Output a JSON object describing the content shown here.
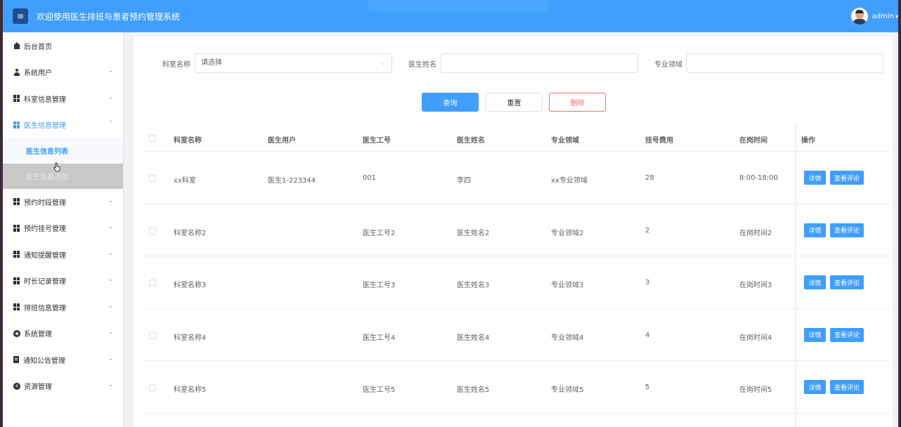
{
  "header": {
    "title": "欢迎使用医生排班与患者预约管理系统",
    "username": "admin"
  },
  "sidebar": {
    "items": [
      {
        "label": "后台首页",
        "icon": "home-icon"
      },
      {
        "label": "系统用户",
        "icon": "user-icon"
      },
      {
        "label": "科室信息管理",
        "icon": "grid-icon"
      },
      {
        "label": "医生信息管理",
        "icon": "grid-icon"
      },
      {
        "label": "预约时段管理",
        "icon": "grid-icon"
      },
      {
        "label": "预约挂号管理",
        "icon": "grid-icon"
      },
      {
        "label": "通知提醒管理",
        "icon": "grid-icon"
      },
      {
        "label": "时长记录管理",
        "icon": "grid-icon"
      },
      {
        "label": "排班信息管理",
        "icon": "grid-icon"
      },
      {
        "label": "系统管理",
        "icon": "gear-icon"
      },
      {
        "label": "通知公告管理",
        "icon": "doc-icon"
      },
      {
        "label": "资源管理",
        "icon": "plus-icon"
      }
    ],
    "submenu": {
      "active": "医生信息列表",
      "hovered": "医生信息添加"
    }
  },
  "filters": {
    "dept_label": "科室名称",
    "dept_placeholder": "请选择",
    "name_label": "医生姓名",
    "field_label": "专业领域"
  },
  "buttons": {
    "query": "查询",
    "reset": "重置",
    "delete": "删除",
    "detail": "详情",
    "review": "查看评论"
  },
  "table": {
    "columns": [
      "科室名称",
      "医生用户",
      "医生工号",
      "医生姓名",
      "专业领域",
      "挂号费用",
      "在岗时间",
      "操作"
    ],
    "rows": [
      [
        "xx科室",
        "医生1-223344",
        "001",
        "李四",
        "xx专业领域",
        "28",
        "8:00-18:00"
      ],
      [
        "科室名称2",
        "",
        "医生工号2",
        "医生姓名2",
        "专业领域2",
        "2",
        "在岗时间2"
      ],
      [
        "科室名称3",
        "",
        "医生工号3",
        "医生姓名3",
        "专业领域3",
        "3",
        "在岗时间3"
      ],
      [
        "科室名称4",
        "",
        "医生工号4",
        "医生姓名4",
        "专业领域4",
        "4",
        "在岗时间4"
      ],
      [
        "科室名称5",
        "",
        "医生工号5",
        "医生姓名5",
        "专业领域5",
        "5",
        "在岗时间5"
      ]
    ]
  }
}
